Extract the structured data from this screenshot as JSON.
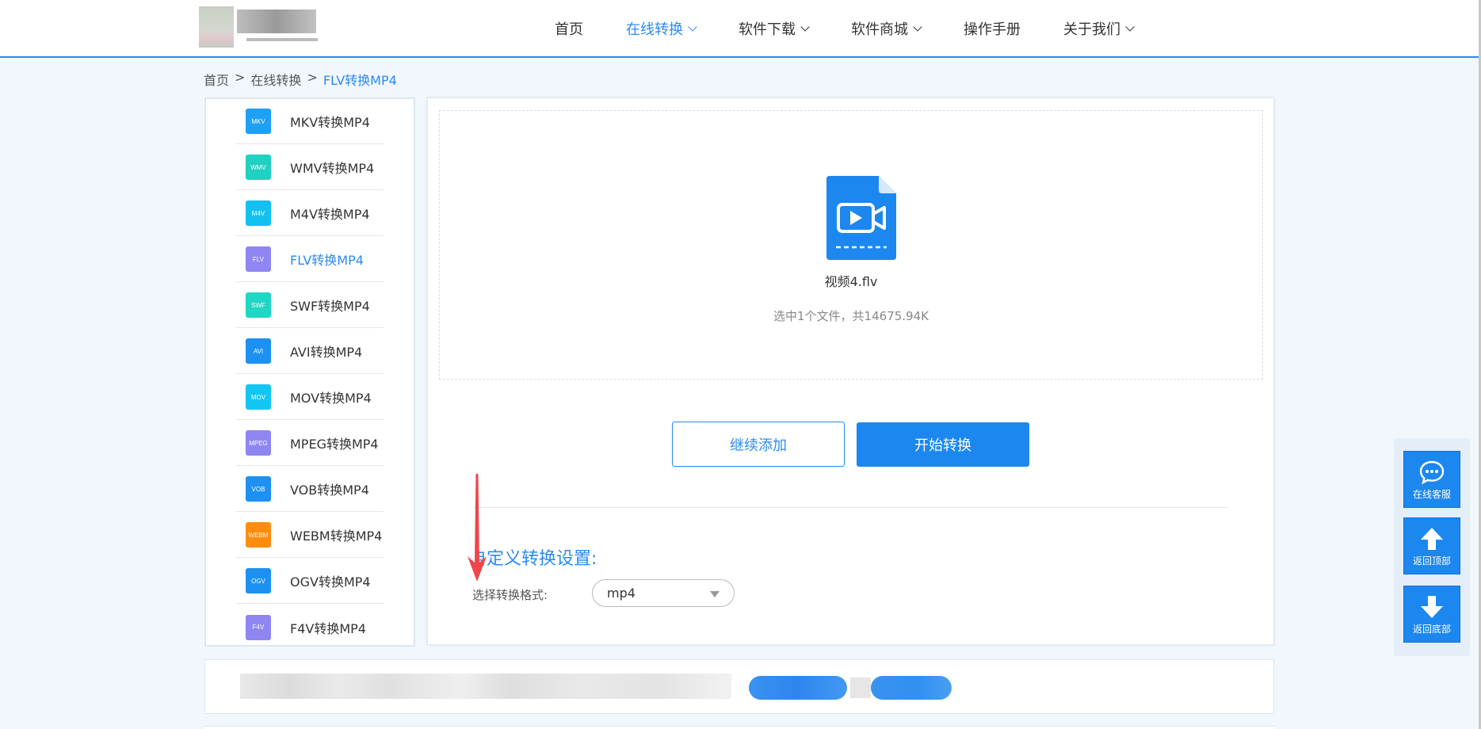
{
  "header": {
    "nav": [
      {
        "label": "首页",
        "has_dropdown": false,
        "active": false
      },
      {
        "label": "在线转换",
        "has_dropdown": true,
        "active": true
      },
      {
        "label": "软件下载",
        "has_dropdown": true,
        "active": false
      },
      {
        "label": "软件商城",
        "has_dropdown": true,
        "active": false
      },
      {
        "label": "操作手册",
        "has_dropdown": false,
        "active": false
      },
      {
        "label": "关于我们",
        "has_dropdown": true,
        "active": false
      }
    ]
  },
  "breadcrumb": {
    "items": [
      "首页",
      "在线转换",
      "FLV转换MP4"
    ],
    "separator": ">"
  },
  "sidebar": {
    "items": [
      {
        "icon_text": "MKV",
        "label": "MKV转换MP4",
        "color": "#1ea0f5",
        "active": false
      },
      {
        "icon_text": "WMV",
        "label": "WMV转换MP4",
        "color": "#1fd1c1",
        "active": false
      },
      {
        "icon_text": "M4V",
        "label": "M4V转换MP4",
        "color": "#12c1f0",
        "active": false
      },
      {
        "icon_text": "FLV",
        "label": "FLV转换MP4",
        "color": "#8f86f2",
        "active": true
      },
      {
        "icon_text": "SWF",
        "label": "SWF转换MP4",
        "color": "#1fd7c4",
        "active": false
      },
      {
        "icon_text": "AVI",
        "label": "AVI转换MP4",
        "color": "#1d91f2",
        "active": false
      },
      {
        "icon_text": "MOV",
        "label": "MOV转换MP4",
        "color": "#14c6f2",
        "active": false
      },
      {
        "icon_text": "MPEG",
        "label": "MPEG转换MP4",
        "color": "#8f86f2",
        "active": false
      },
      {
        "icon_text": "VOB",
        "label": "VOB转换MP4",
        "color": "#1d91f2",
        "active": false
      },
      {
        "icon_text": "WEBM",
        "label": "WEBM转换MP4",
        "color": "#ff8c0d",
        "active": false
      },
      {
        "icon_text": "OGV",
        "label": "OGV转换MP4",
        "color": "#1d91f2",
        "active": false
      },
      {
        "icon_text": "F4V",
        "label": "F4V转换MP4",
        "color": "#8f86f2",
        "active": false
      }
    ]
  },
  "main": {
    "file_name": "视频4.flv",
    "file_summary": "选中1个文件，共14675.94K",
    "add_button": "继续添加",
    "start_button": "开始转换",
    "settings_title": "自定义转换设置:",
    "format_label": "选择转换格式:",
    "format_value": "mp4"
  },
  "float_tools": [
    {
      "icon": "chat-bubble-icon",
      "label": "在线客服"
    },
    {
      "icon": "arrow-up-icon",
      "label": "返回顶部"
    },
    {
      "icon": "arrow-down-icon",
      "label": "返回底部"
    }
  ],
  "colors": {
    "accent": "#2b8af5",
    "button": "#1d87f0",
    "background": "#f1f7fd",
    "annotation_arrow": "#f0464a"
  }
}
